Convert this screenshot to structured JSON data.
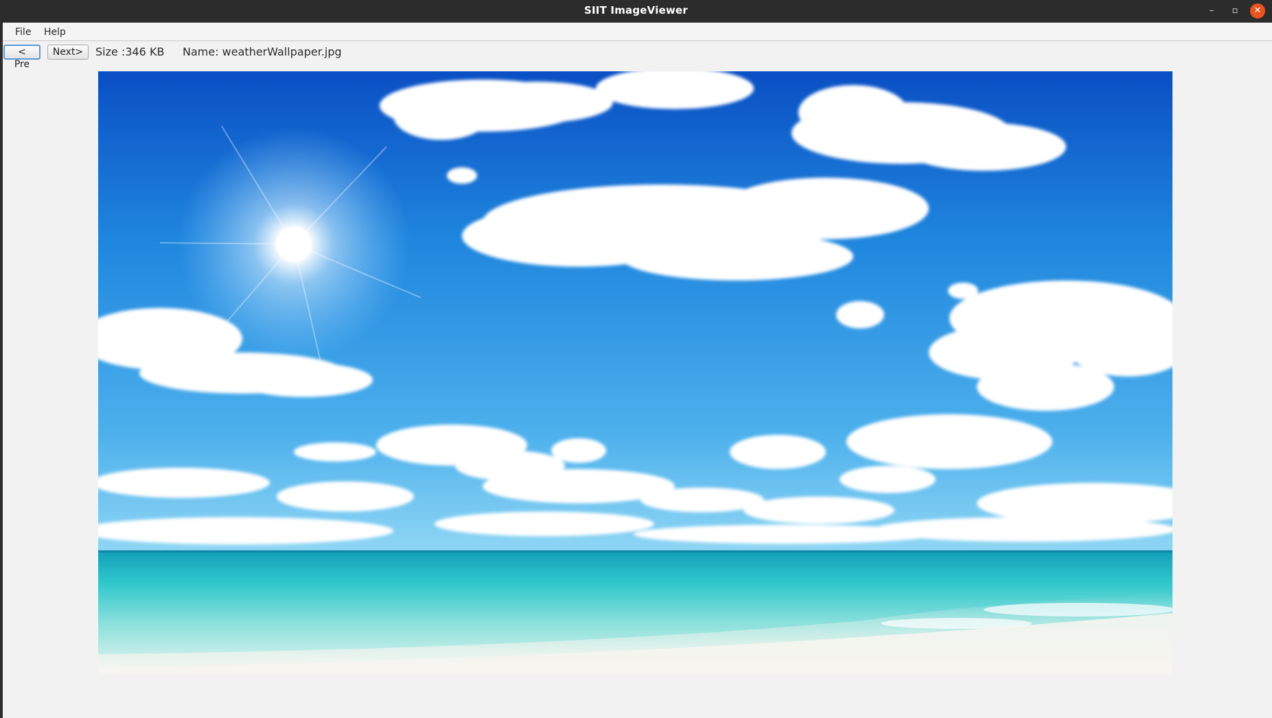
{
  "window": {
    "title": "SIIT ImageViewer",
    "controls": {
      "minimize": "–",
      "maximize": "▫",
      "close": "✕"
    },
    "colors": {
      "titlebar": "#2c2c2c",
      "close_button": "#e95420"
    }
  },
  "menubar": {
    "items": [
      {
        "label": "File"
      },
      {
        "label": "Help"
      }
    ]
  },
  "toolbar": {
    "prev_label": "< Pre",
    "next_label": "Next>",
    "size_text": "Size :346 KB",
    "name_text": "Name: weatherWallpaper.jpg"
  },
  "image": {
    "subject": "sunny-sky-beach-wallpaper",
    "colors": {
      "sky_top": "#0a4fc4",
      "sky_bottom": "#7fd0f2",
      "sea": "#2fc7cc",
      "sand": "#f3f3ee"
    }
  }
}
